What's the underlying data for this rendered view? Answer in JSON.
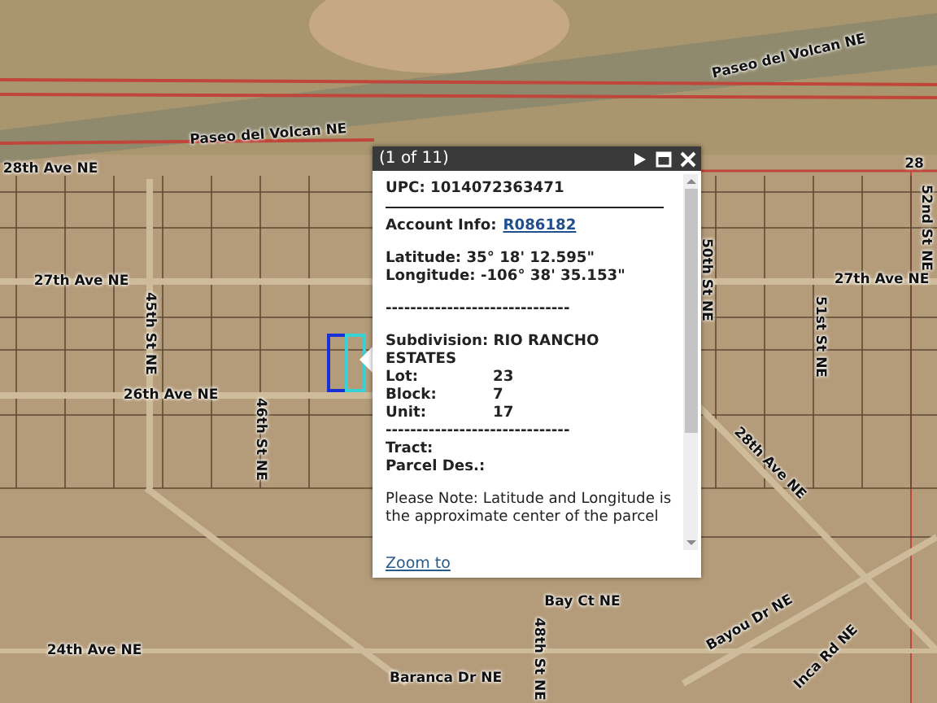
{
  "map": {
    "labels": [
      {
        "text": "Paseo del Volcan NE"
      },
      {
        "text": "Paseo del Volcan NE"
      },
      {
        "text": "28th Ave NE"
      },
      {
        "text": "28"
      },
      {
        "text": "27th Ave NE"
      },
      {
        "text": "45th St NE"
      },
      {
        "text": "26th Ave NE"
      },
      {
        "text": "46th St NE"
      },
      {
        "text": "24th Ave NE"
      },
      {
        "text": "Baranca Dr NE"
      },
      {
        "text": "Bay Ct NE"
      },
      {
        "text": "48th St NE"
      },
      {
        "text": "27th Ave NE"
      },
      {
        "text": "50th St NE"
      },
      {
        "text": "51st St NE"
      },
      {
        "text": "52nd St NE"
      },
      {
        "text": "28th Ave NE"
      },
      {
        "text": "Bayou Dr NE"
      },
      {
        "text": "Inca Rd NE"
      }
    ]
  },
  "popup": {
    "title": "(1 of 11)",
    "upc": "UPC: 1014072363471",
    "account_label": "Account Info:",
    "account_link": "R086182",
    "latitude": "Latitude: 35° 18' 12.595\"",
    "longitude": "Longitude: -106° 38' 35.153\"",
    "separator": "------------------------------",
    "subdivision": "Subdivision: RIO RANCHO ESTATES",
    "fields": [
      {
        "label": "Lot:",
        "value": "23"
      },
      {
        "label": "Block:",
        "value": "7"
      },
      {
        "label": "Unit:",
        "value": "17"
      }
    ],
    "separator_2": "------------------------------",
    "tract": "Tract:",
    "parcel_description": "Parcel Des.:",
    "note": "Please Note: Latitude and Longitude is the approximate center of the parcel",
    "zoom_link": "Zoom to"
  }
}
